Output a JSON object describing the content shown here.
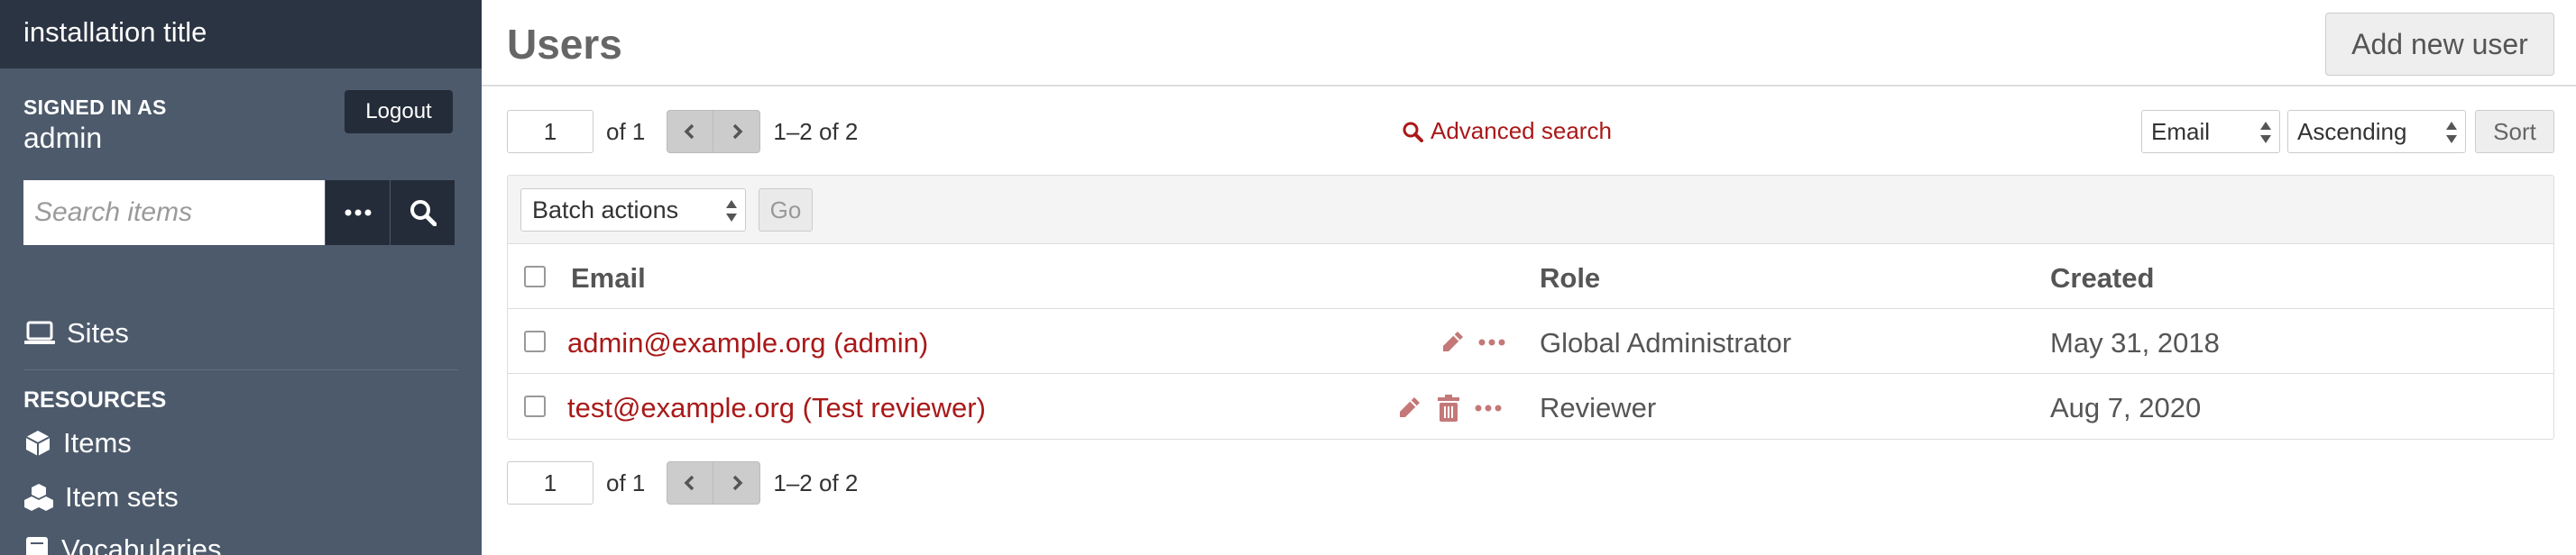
{
  "sidebar": {
    "install_title": "installation title",
    "signed_in_label": "SIGNED IN AS",
    "user": "admin",
    "logout_label": "Logout",
    "search_placeholder": "Search items",
    "sites_label": "Sites",
    "resources_label": "RESOURCES",
    "resources": [
      "Items",
      "Item sets",
      "Vocabularies"
    ]
  },
  "header": {
    "title": "Users",
    "add_user_label": "Add new user"
  },
  "pagination": {
    "page": "1",
    "of_label": "of 1",
    "range": "1–2 of 2"
  },
  "advanced_search_label": "Advanced search",
  "sorting": {
    "sort_by": "Email",
    "order": "Ascending",
    "sort_label": "Sort"
  },
  "batch": {
    "select_label": "Batch actions",
    "go_label": "Go"
  },
  "table": {
    "columns": {
      "email": "Email",
      "role": "Role",
      "created": "Created"
    },
    "rows": [
      {
        "email": "admin@example.org (admin)",
        "role": "Global Administrator",
        "created": "May 31, 2018"
      },
      {
        "email": "test@example.org (Test reviewer)",
        "role": "Reviewer",
        "created": "Aug 7, 2020"
      }
    ]
  },
  "colors": {
    "sidebar_bg": "#4c5a6b",
    "sidebar_dark": "#2b3442",
    "link": "#a91919"
  }
}
